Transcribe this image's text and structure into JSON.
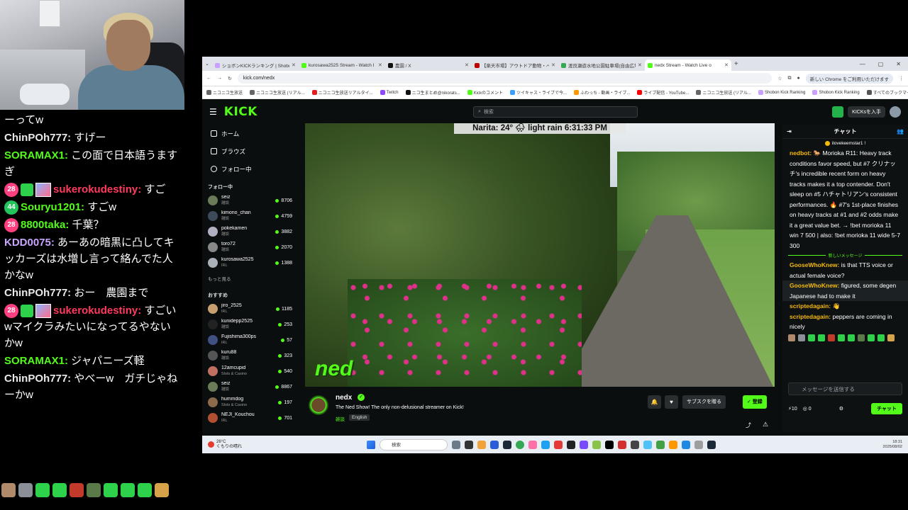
{
  "left_chat": [
    {
      "user": "",
      "text": "ーってw",
      "color": "white",
      "badges": []
    },
    {
      "user": "ChinPOh777:",
      "text": " すげー",
      "color": "white",
      "badges": []
    },
    {
      "user": "SORAMAX1:",
      "text": " この面で日本語うますぎ",
      "color": "green",
      "badges": []
    },
    {
      "user": "sukerokudestiny:",
      "text": " すご",
      "color": "red",
      "badges": [
        "28",
        "gift",
        "sub"
      ]
    },
    {
      "user": "Souryu1201:",
      "text": " すごw",
      "color": "green",
      "badges": [
        "44"
      ]
    },
    {
      "user": "8800taka:",
      "text": " 千葉？",
      "color": "green",
      "badges": [
        "28"
      ]
    },
    {
      "user": "KDD0075:",
      "text": " あーあの暗黒に凸してキッカーズは水増し言って絡んでた人かなw",
      "color": "purple",
      "badges": []
    },
    {
      "user": "ChinPOh777:",
      "text": " おー　農園まで",
      "color": "white",
      "badges": []
    },
    {
      "user": "sukerokudestiny:",
      "text": " すごいwマイクラみたいになってるやないかw",
      "color": "red",
      "badges": [
        "28",
        "gift",
        "sub"
      ]
    },
    {
      "user": "SORAMAX1:",
      "text": " ジャパニーズ軽",
      "color": "green",
      "badges": []
    },
    {
      "user": "ChinPOh777:",
      "text": " やべーw　ガチじゃねーかw",
      "color": "white",
      "badges": []
    }
  ],
  "browser": {
    "tabs": [
      {
        "title": "ショボンKICKランキング | Shobon K",
        "active": false,
        "color": "#c9a0ff"
      },
      {
        "title": "kurosawa2525 Stream - Watch I",
        "active": false,
        "color": "#53fc18"
      },
      {
        "title": "農園 / X",
        "active": false,
        "color": "#111111"
      },
      {
        "title": "【楽天市場】アウトドア動物・ペット",
        "active": false,
        "color": "#bf0000"
      },
      {
        "title": "渡良瀬遊水地公園駐車場(自由広場)",
        "active": false,
        "color": "#34a853"
      },
      {
        "title": "nedx Stream - Watch Live o",
        "active": true,
        "color": "#53fc18"
      }
    ],
    "new_tab": "+",
    "url": "kick.com/nedx",
    "chrome_badge": "新しい Chrome をご利用いただけます",
    "bookmarks": [
      {
        "label": "ニコニコ生放送",
        "color": "#666666"
      },
      {
        "label": "ニコニコ生放送 (リアル...",
        "color": "#666666"
      },
      {
        "label": "ニコニコ生放送リアルタイ...",
        "color": "#e02020"
      },
      {
        "label": "Twitch",
        "color": "#9146ff"
      },
      {
        "label": "ニコ生まとめ@nikorats...",
        "color": "#111111"
      },
      {
        "label": "Kickのコメント",
        "color": "#53fc18"
      },
      {
        "label": "ツイキャス・ライブで今...",
        "color": "#3aa0ff"
      },
      {
        "label": "ふわっち - 動画・ライブ...",
        "color": "#ff9800"
      },
      {
        "label": "ライブ配信 - YouTube...",
        "color": "#ff0000"
      },
      {
        "label": "ニコニコ生放送 (リアル...",
        "color": "#666666"
      },
      {
        "label": "Shobon Kick Ranking",
        "color": "#c9a0ff"
      },
      {
        "label": "Shobon Kick Ranking",
        "color": "#c9a0ff"
      },
      {
        "label": "すべてのブックマーク",
        "color": "#555555"
      }
    ]
  },
  "kick": {
    "logo": "KICK",
    "search_placeholder": "検索",
    "kicks_button": "KICKsを入手",
    "nav": [
      {
        "label": "ホーム"
      },
      {
        "label": "ブラウズ"
      },
      {
        "label": "フォロー中"
      }
    ],
    "following_title": "フォロー中",
    "following": [
      {
        "name": "seiz",
        "cat": "雑談",
        "viewers": "8706",
        "color": "#6b7b5a"
      },
      {
        "name": "kimono_chan",
        "cat": "雑談",
        "viewers": "4759",
        "color": "#3d4a5a"
      },
      {
        "name": "pokekamen",
        "cat": "雑談",
        "viewers": "3882",
        "color": "#b0b0c0"
      },
      {
        "name": "toro72",
        "cat": "雑談",
        "viewers": "2070",
        "color": "#888888"
      },
      {
        "name": "kurosawa2525",
        "cat": "IRL",
        "viewers": "1388",
        "color": "#aab0b8"
      }
    ],
    "more_label": "もっと見る",
    "recommended_title": "おすすめ",
    "recommended": [
      {
        "name": "jiro_2525",
        "cat": "IRL",
        "viewers": "1185",
        "color": "#c8a070"
      },
      {
        "name": "kunidepp2525",
        "cat": "雑談",
        "viewers": "253",
        "color": "#222222"
      },
      {
        "name": "Fujishima300ps",
        "cat": "IRL",
        "viewers": "57",
        "color": "#405080"
      },
      {
        "name": "kuru88",
        "cat": "雑談",
        "viewers": "323",
        "color": "#555555"
      },
      {
        "name": "12amcupid",
        "cat": "Slots & Casino",
        "viewers": "540",
        "color": "#c07060"
      },
      {
        "name": "seiz",
        "cat": "雑談",
        "viewers": "8867",
        "color": "#6b7b5a"
      },
      {
        "name": "hummdog",
        "cat": "Slots & Casino",
        "viewers": "197",
        "color": "#8a6a4a"
      },
      {
        "name": "NEJI_Kouchou",
        "cat": "IRL",
        "viewers": "701",
        "color": "#b05030"
      }
    ],
    "weather_overlay": "Narita: 24° 🌧 light rain 6:31:33 PM",
    "video_watermark": "ned",
    "streamer": "nedx",
    "stream_title": "The Ned Show! The only non-delusional streamer on Kick!",
    "category": "雑談",
    "language": "English",
    "subscribe_label": "サブスクを贈る",
    "follow_label": "✓ 登録",
    "chat": {
      "title": "チャット",
      "pinned": "ilovekeemstar1 !",
      "messages_before": [
        {
          "user": "nedbot:",
          "text": " 🐎 Morioka R11: Heavy track conditions favor speed, but #7 クリナッチ's incredible recent form on heavy tracks makes it a top contender. Don't sleep on #5 ハチャトリアン's consistent performances. 🔥 #7's 1st-place finishes on heavy tracks at #1 and #2 odds make it a great value bet. → !bet morioka 11 win 7 500 | also: !bet morioka 11 wide 5-7 300"
        }
      ],
      "new_messages_label": "新しいメッセージ",
      "messages_after": [
        {
          "user": "GooseWhoKnew:",
          "text": " is that TTS voice or actual female voice?",
          "hl": false
        },
        {
          "user": "GooseWhoKnew:",
          "text": " figured, some degen Japanese had to make it",
          "hl": true
        },
        {
          "user": "scriptedagain:",
          "text": " 👋",
          "hl": false
        },
        {
          "user": "scriptedagain:",
          "text": " peppers are coming in nicely",
          "hl": false
        }
      ],
      "input_placeholder": "メッセージを送信する",
      "kicks_count": "10",
      "other_count": "0",
      "send_label": "チャット"
    }
  },
  "taskbar": {
    "weather": "26°C",
    "weather_desc": "くもりの晴れ",
    "search": "検索",
    "time": "18:31",
    "date": "2025/08/02"
  }
}
